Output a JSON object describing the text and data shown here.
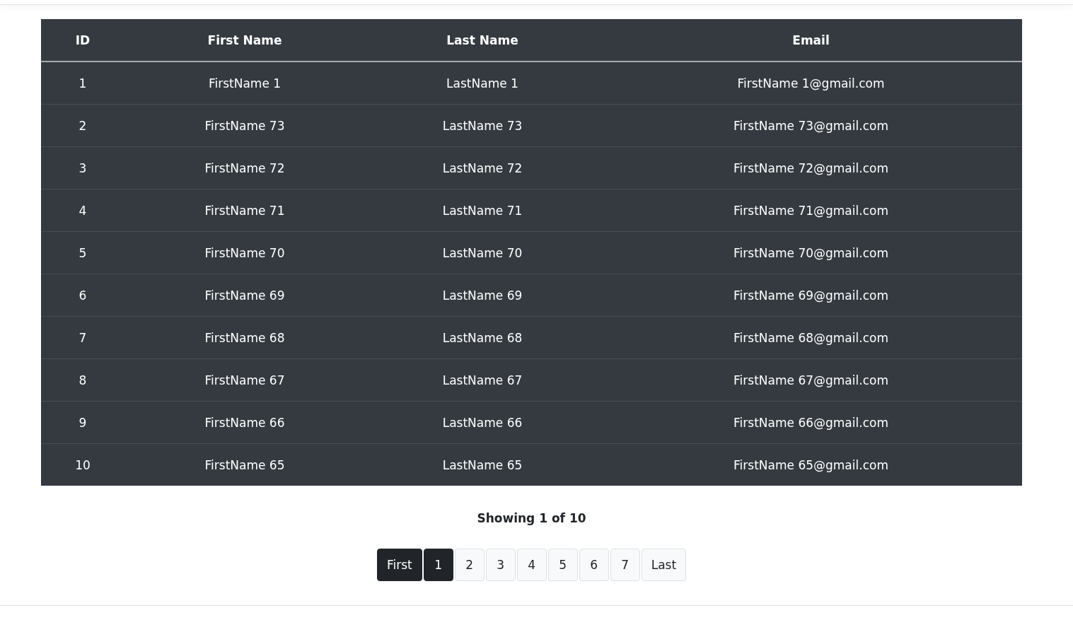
{
  "table": {
    "columns": [
      "ID",
      "First Name",
      "Last Name",
      "Email"
    ],
    "rows": [
      [
        "1",
        "FirstName 1",
        "LastName 1",
        "FirstName 1@gmail.com"
      ],
      [
        "2",
        "FirstName 73",
        "LastName 73",
        "FirstName 73@gmail.com"
      ],
      [
        "3",
        "FirstName 72",
        "LastName 72",
        "FirstName 72@gmail.com"
      ],
      [
        "4",
        "FirstName 71",
        "LastName 71",
        "FirstName 71@gmail.com"
      ],
      [
        "5",
        "FirstName 70",
        "LastName 70",
        "FirstName 70@gmail.com"
      ],
      [
        "6",
        "FirstName 69",
        "LastName 69",
        "FirstName 69@gmail.com"
      ],
      [
        "7",
        "FirstName 68",
        "LastName 68",
        "FirstName 68@gmail.com"
      ],
      [
        "8",
        "FirstName 67",
        "LastName 67",
        "FirstName 67@gmail.com"
      ],
      [
        "9",
        "FirstName 66",
        "LastName 66",
        "FirstName 66@gmail.com"
      ],
      [
        "10",
        "FirstName 65",
        "LastName 65",
        "FirstName 65@gmail.com"
      ]
    ]
  },
  "summary": "Showing 1 of 10",
  "pagination": [
    {
      "label": "First",
      "selected": true
    },
    {
      "label": "1",
      "selected": true
    },
    {
      "label": "2",
      "selected": false
    },
    {
      "label": "3",
      "selected": false
    },
    {
      "label": "4",
      "selected": false
    },
    {
      "label": "5",
      "selected": false
    },
    {
      "label": "6",
      "selected": false
    },
    {
      "label": "7",
      "selected": false
    },
    {
      "label": "Last",
      "selected": false
    }
  ]
}
